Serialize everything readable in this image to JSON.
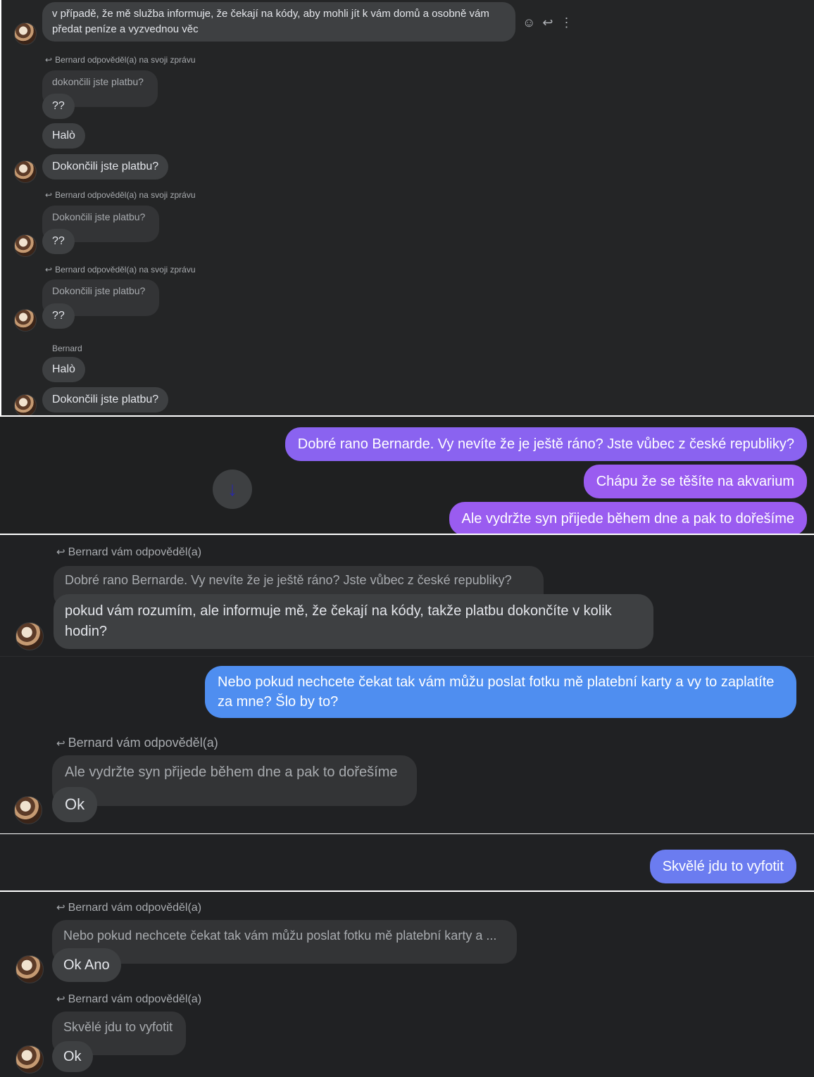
{
  "panel1": {
    "top_message": "v případě, že mě služba informuje, že čekají na kódy, aby mohli jít k vám domů a osobně vám předat peníze a vyzvednou věc",
    "actions": {
      "emoji": "☺",
      "reply": "↩",
      "more": "⋮"
    },
    "reply_header": "Bernard odpověděl(a) na svoji zprávu",
    "quote1": "dokončili jste platbu?",
    "q_marks": "??",
    "halo": "Halò",
    "dokoncili": "Dokončili jste platbu?",
    "quote2": "Dokončili jste platbu?",
    "sender": "Bernard"
  },
  "panel2": {
    "msg1": "Dobré rano Bernarde. Vy nevíte že je ještě ráno? Jste vůbec z české republiky?",
    "msg2": "Chápu že se těšíte na akvarium",
    "msg3": "Ale vydržte syn přijede během dne a pak to dořešíme",
    "scroll_icon": "↓"
  },
  "panel3": {
    "reply_header": "Bernard vám odpověděl(a)",
    "quote": "Dobré rano Bernarde. Vy nevíte že je ještě ráno? Jste vůbec z české republiky?",
    "message": "pokud vám rozumím, ale informuje mě, že čekají na kódy, takže platbu dokončíte v kolik hodin?"
  },
  "panel4": {
    "my_message": "Nebo pokud nechcete čekat tak vám můžu poslat fotku mě platební karty a vy to zaplatíte za mne? Šlo by to?",
    "reply_header": "Bernard vám odpověděl(a)",
    "quote": "Ale vydržte syn přijede během dne a pak to dořešíme",
    "message": "Ok"
  },
  "panel5": {
    "my_message": "Skvělé jdu to vyfotit"
  },
  "panel6": {
    "reply_header1": "Bernard vám odpověděl(a)",
    "quote1": "Nebo pokud nechcete čekat tak vám můžu poslat fotku mě platební karty a ...",
    "message1": "Ok Ano",
    "reply_header2": "Bernard vám odpověděl(a)",
    "quote2": "Skvělé jdu to vyfotit",
    "message2": "Ok"
  },
  "colors": {
    "background": "#242526",
    "incoming_bubble": "#3e4042",
    "purple_bubble": "#8a63f0",
    "violet_bubble": "#9a5cf0",
    "blue_bubble": "#4f8ef0",
    "indigo_bubble": "#6b7cf0"
  }
}
